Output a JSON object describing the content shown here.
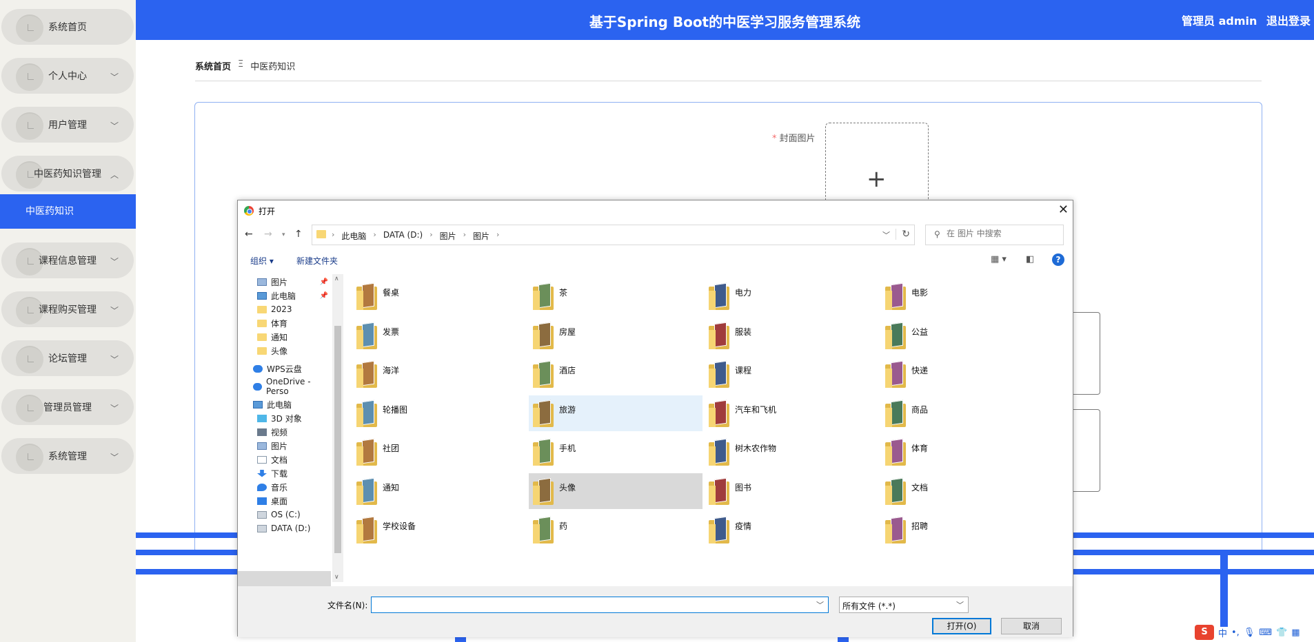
{
  "app": {
    "title": "基于Spring Boot的中医学习服务管理系统",
    "user_label": "管理员 admin",
    "logout": "退出登录"
  },
  "sidebar": {
    "items": [
      {
        "label": "系统首页",
        "arrow": ""
      },
      {
        "label": "个人中心",
        "arrow": "﹀"
      },
      {
        "label": "用户管理",
        "arrow": "﹀"
      },
      {
        "label": "中医药知识管理",
        "arrow": "︿"
      },
      {
        "label": "课程信息管理",
        "arrow": "﹀"
      },
      {
        "label": "课程购买管理",
        "arrow": "﹀"
      },
      {
        "label": "论坛管理",
        "arrow": "﹀"
      },
      {
        "label": "管理员管理",
        "arrow": "﹀"
      },
      {
        "label": "系统管理",
        "arrow": "﹀"
      }
    ],
    "active_sub": "中医药知识"
  },
  "breadcrumb": {
    "home": "系统首页",
    "sep": "Ξ",
    "current": "中医药知识"
  },
  "form": {
    "cover_required": "*",
    "cover_label": "封面图片",
    "upload_plus": "+"
  },
  "dialog": {
    "title": "打开",
    "close": "✕",
    "path": [
      "此电脑",
      "DATA (D:)",
      "图片",
      "图片"
    ],
    "search_placeholder": "在 图片 中搜索",
    "organize": "组织 ▾",
    "new_folder": "新建文件夹",
    "help": "?",
    "tree": [
      {
        "label": "图片",
        "icon": "ico-pic",
        "pinned": true
      },
      {
        "label": "此电脑",
        "icon": "ico-pc",
        "pinned": true
      },
      {
        "label": "2023",
        "icon": "ico-folder",
        "pinned": false
      },
      {
        "label": "体育",
        "icon": "ico-folder",
        "pinned": false
      },
      {
        "label": "通知",
        "icon": "ico-folder",
        "pinned": false
      },
      {
        "label": "头像",
        "icon": "ico-folder",
        "pinned": false
      },
      {
        "label": "WPS云盘",
        "icon": "ico-cloud",
        "pinned": false
      },
      {
        "label": "OneDrive - Perso",
        "icon": "ico-cloud",
        "pinned": false
      },
      {
        "label": "此电脑",
        "icon": "ico-pc",
        "pinned": false
      },
      {
        "label": "3D 对象",
        "icon": "ico-3d",
        "pinned": false
      },
      {
        "label": "视频",
        "icon": "ico-video",
        "pinned": false
      },
      {
        "label": "图片",
        "icon": "ico-pic",
        "pinned": false
      },
      {
        "label": "文档",
        "icon": "ico-doc",
        "pinned": false
      },
      {
        "label": "下载",
        "icon": "ico-dl",
        "pinned": false
      },
      {
        "label": "音乐",
        "icon": "ico-music",
        "pinned": false
      },
      {
        "label": "桌面",
        "icon": "ico-desk",
        "pinned": false
      },
      {
        "label": "OS (C:)",
        "icon": "ico-drive",
        "pinned": false
      },
      {
        "label": "DATA (D:)",
        "icon": "ico-drive",
        "pinned": false
      }
    ],
    "folders": [
      "餐桌",
      "茶",
      "电力",
      "电影",
      "发票",
      "房屋",
      "服装",
      "公益",
      "海洋",
      "酒店",
      "课程",
      "快递",
      "轮播图",
      "旅游",
      "汽车和飞机",
      "商品",
      "社团",
      "手机",
      "树木农作物",
      "体育",
      "通知",
      "头像",
      "图书",
      "文档",
      "学校设备",
      "药",
      "疫情",
      "招聘"
    ],
    "hover_folder": "旅游",
    "selected_folder": "头像",
    "filename_label": "文件名(N):",
    "filename_value": "",
    "filter": "所有文件 (*.*)",
    "open_button": "打开(O)",
    "cancel_button": "取消"
  },
  "tray": {
    "ime_logo": "S",
    "ime_lang": "中"
  },
  "colors": {
    "brand_blue": "#2b63f0",
    "folder_yellow": "#f6d573"
  }
}
